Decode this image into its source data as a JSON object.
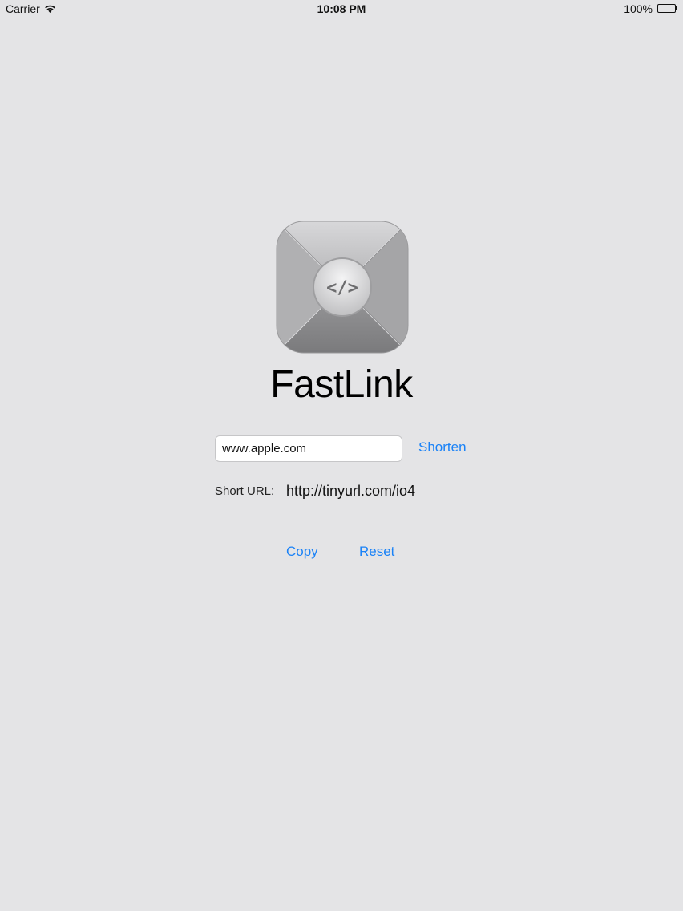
{
  "status_bar": {
    "carrier": "Carrier",
    "time": "10:08 PM",
    "battery_percent": "100%",
    "battery_level": 1.0,
    "icons": [
      "wifi-icon",
      "battery-icon"
    ]
  },
  "app": {
    "title": "FastLink",
    "icon_glyph": "</>",
    "icon_name": "fastlink-app-icon"
  },
  "form": {
    "url_value": "www.apple.com",
    "shorten_label": "Shorten",
    "short_url_label": "Short URL:",
    "short_url_value": "http://tinyurl.com/io4"
  },
  "actions": {
    "copy_label": "Copy",
    "reset_label": "Reset"
  },
  "colors": {
    "background": "#e4e4e6",
    "accent": "#1a82f7"
  }
}
